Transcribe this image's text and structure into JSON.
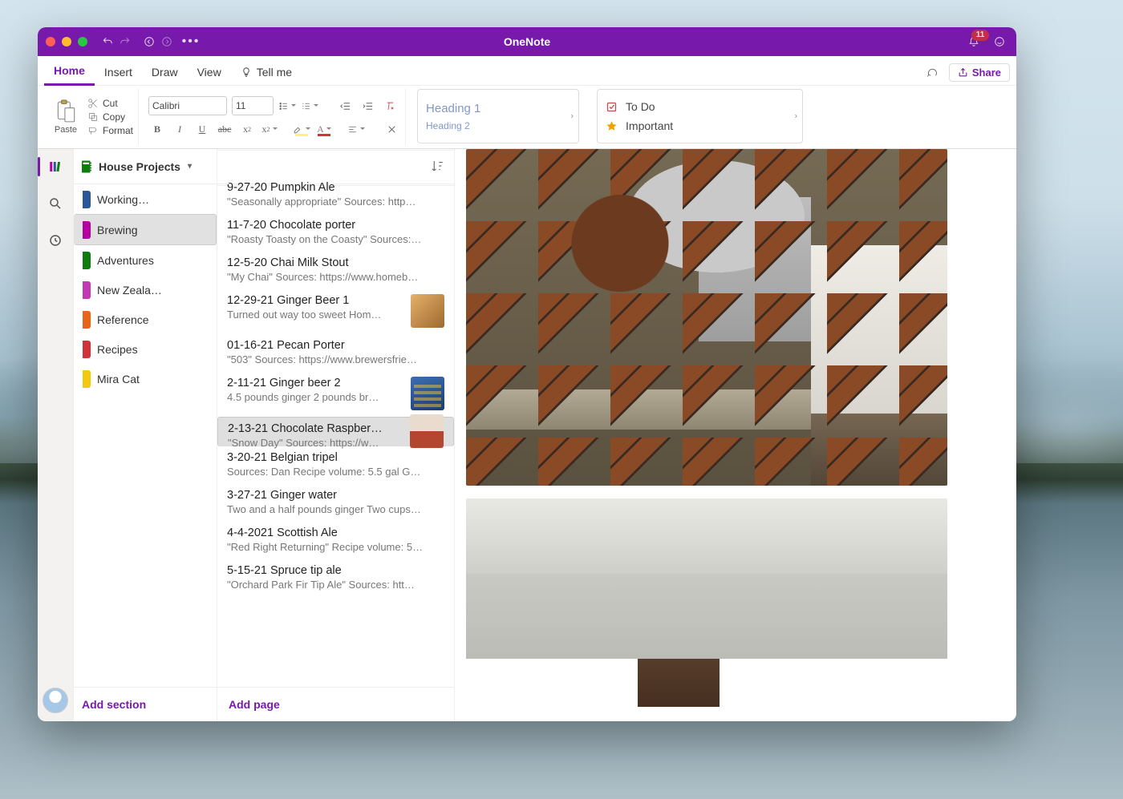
{
  "app_title": "OneNote",
  "notifications_count": "11",
  "menu": {
    "home": "Home",
    "insert": "Insert",
    "draw": "Draw",
    "view": "View",
    "tell_me": "Tell me",
    "share": "Share"
  },
  "ribbon": {
    "paste": "Paste",
    "cut": "Cut",
    "copy": "Copy",
    "format": "Format",
    "font_name": "Calibri",
    "font_size": "11",
    "heading1": "Heading 1",
    "heading2": "Heading 2",
    "tag_todo": "To Do",
    "tag_important": "Important"
  },
  "notebook": {
    "name": "House Projects"
  },
  "sections": [
    {
      "label": "Working…",
      "color": "#2b579a"
    },
    {
      "label": "Brewing",
      "color": "#b4009e",
      "selected": true
    },
    {
      "label": "Adventures",
      "color": "#107c10"
    },
    {
      "label": "New Zeala…",
      "color": "#c239b3"
    },
    {
      "label": "Reference",
      "color": "#e8641b"
    },
    {
      "label": "Recipes",
      "color": "#d13438"
    },
    {
      "label": "Mira Cat",
      "color": "#f2c811"
    }
  ],
  "add_section": "Add section",
  "add_page": "Add page",
  "pages": [
    {
      "title": "9-27-20 Pumpkin Ale",
      "sub": "\"Seasonally appropriate\"  Sources: http…",
      "partial": true
    },
    {
      "title": "11-7-20 Chocolate porter",
      "sub": "\"Roasty Toasty on the Coasty\"  Sources:…"
    },
    {
      "title": "12-5-20 Chai Milk Stout",
      "sub": "\"My Chai\"  Sources: https://www.homeb…"
    },
    {
      "title": "12-29-21 Ginger Beer 1",
      "sub": "Turned out way too sweet  Hom…",
      "thumb": "ginger"
    },
    {
      "title": "01-16-21 Pecan Porter",
      "sub": "\"503\"  Sources: https://www.brewersfrie…"
    },
    {
      "title": "2-11-21 Ginger beer 2",
      "sub": "4.5 pounds ginger  2 pounds br…",
      "thumb": "gb2"
    },
    {
      "title": "2-13-21 Chocolate Raspber…",
      "sub": "\"Snow Day\"  Sources: https://w…",
      "thumb": "rasp",
      "selected": true
    },
    {
      "title": "3-20-21 Belgian tripel",
      "sub": "Sources: Dan  Recipe volume: 5.5 gal  G…"
    },
    {
      "title": "3-27-21 Ginger water",
      "sub": "Two and a half pounds ginger  Two cups…"
    },
    {
      "title": "4-4-2021 Scottish Ale",
      "sub": "\"Red Right Returning\"  Recipe volume: 5…"
    },
    {
      "title": "5-15-21 Spruce tip ale",
      "sub": "\"Orchard Park Fir Tip Ale\"  Sources:  htt…"
    }
  ]
}
